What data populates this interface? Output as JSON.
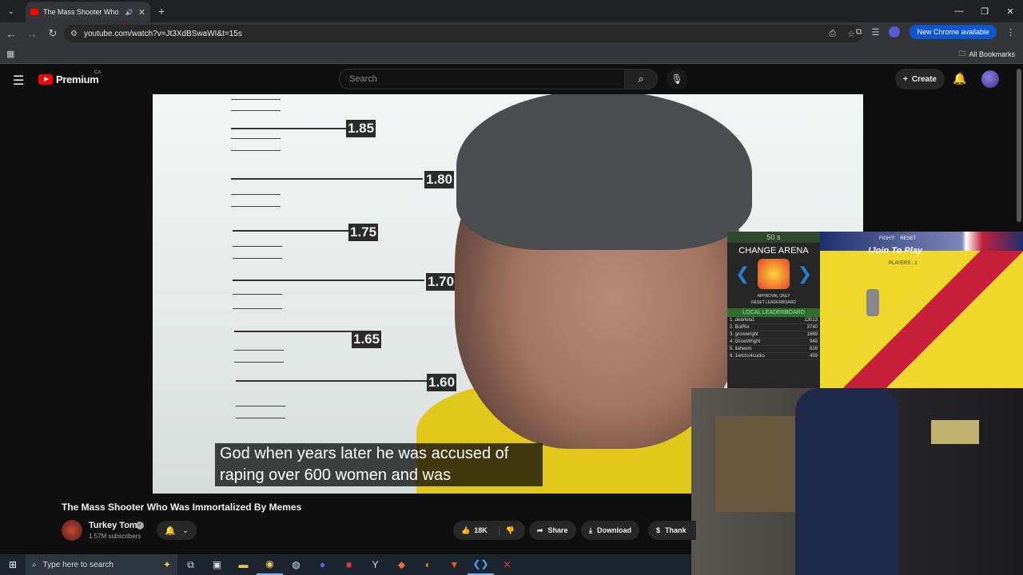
{
  "browser": {
    "tab_title": "The Mass Shooter Who Was Immortalized By Memes",
    "url": "youtube.com/watch?v=Jt3XdBSwaWI&t=15s",
    "new_chrome_label": "New Chrome available",
    "all_bookmarks": "All Bookmarks"
  },
  "youtube": {
    "logo_text": "Premium",
    "country": "CA",
    "search_placeholder": "Search",
    "create_label": "Create"
  },
  "video": {
    "ruler_labels": [
      "1.85",
      "1.80",
      "1.75",
      "1.70",
      "1.65",
      "1.60"
    ],
    "subtitle_line1": "God when years later he was accused of",
    "subtitle_line2": "raping over 600 women and was",
    "title": "The Mass Shooter Who Was Immortalized By Memes",
    "channel": "Turkey Tom",
    "subscribers": "1.57M subscribers",
    "likes": "18K",
    "share_label": "Share",
    "download_label": "Download",
    "thanks_label": "Thank"
  },
  "game_overlay": {
    "timer": "50 s",
    "change_arena": "CHANGE ARENA",
    "approval_only": "APPROVAL ONLY",
    "reset_leaderboard": "RESET LEADERBOARD",
    "local_leaderboard": "LOCAL LEADERBOARD",
    "fight": "FIGHT!",
    "reset": "RESET",
    "join": "!Join To Play",
    "players": "PLAYERS : 1",
    "leaderboard": [
      {
        "rank": "1. dearlola1",
        "score": "13013"
      },
      {
        "rank": "2. BotRix",
        "score": "3740"
      },
      {
        "rank": "3. growwright",
        "score": "1669"
      },
      {
        "rank": "4. GrowWright",
        "score": "949"
      },
      {
        "rank": "5. ilaheem",
        "score": "616"
      },
      {
        "rank": "6. 1wtchs4cucks",
        "score": "459"
      }
    ]
  },
  "taskbar": {
    "search_placeholder": "Type here to search"
  }
}
